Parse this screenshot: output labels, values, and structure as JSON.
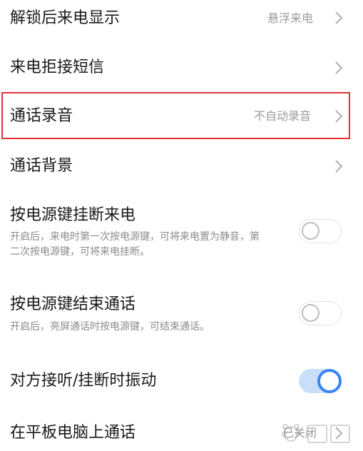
{
  "settings": {
    "unlock_display": {
      "title": "解锁后来电显示",
      "value": "悬浮来电"
    },
    "reject_sms": {
      "title": "来电拒接短信"
    },
    "call_recording": {
      "title": "通话录音",
      "value": "不自动录音"
    },
    "call_background": {
      "title": "通话背景"
    },
    "power_hangup": {
      "title": "按电源键挂断来电",
      "description": "开启后，来电时第一次按电源键，可将来电置为静音，第二次按电源键，可将来电挂断。",
      "enabled": false
    },
    "power_end_call": {
      "title": "按电源键结束通话",
      "description": "开启后，亮屏通话时按电源键，可结束通话。",
      "enabled": false
    },
    "vibrate": {
      "title": "对方接听/挂断时振动",
      "enabled": true
    },
    "tablet_call": {
      "title": "在平板电脑上通话",
      "value": "已关闭"
    }
  },
  "colors": {
    "accent": "#3a84f4",
    "highlight_border": "#e0333a"
  }
}
